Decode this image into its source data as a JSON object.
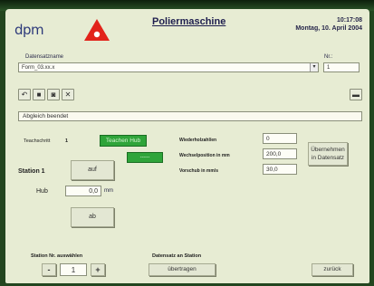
{
  "header": {
    "logo": "dpm",
    "title": "Poliermaschine",
    "time": "10:17:08",
    "date": "Montag, 10. April 2004"
  },
  "file": {
    "record_label": "Datensatzname",
    "record_value": "Form_03.xx.x",
    "nr_label": "Nr.:",
    "nr_value": "1"
  },
  "status_text": "Abgleich beendet",
  "teaching": {
    "label": "Teachschritt",
    "step": "1",
    "button": "Teachen Hub",
    "indicator": "-----"
  },
  "station": {
    "label": "Station 1",
    "up_button": "auf",
    "hub_label": "Hub",
    "hub_value": "0,0",
    "hub_unit": "mm",
    "down_button": "ab"
  },
  "params": [
    {
      "label": "Wiederholzahl/en",
      "value": "0"
    },
    {
      "label": "Wechselposition in mm",
      "value": "200,0"
    },
    {
      "label": "Vorschub in mm/s",
      "value": "30,0"
    }
  ],
  "apply_button": "Übernehmen in Datensatz",
  "station_select": {
    "label": "Station Nr. auswählen",
    "value": "1",
    "minus": "-",
    "plus": "+"
  },
  "transfer": {
    "label": "Datensatz an Station",
    "button": "übertragen"
  },
  "back_button": "zurück"
}
